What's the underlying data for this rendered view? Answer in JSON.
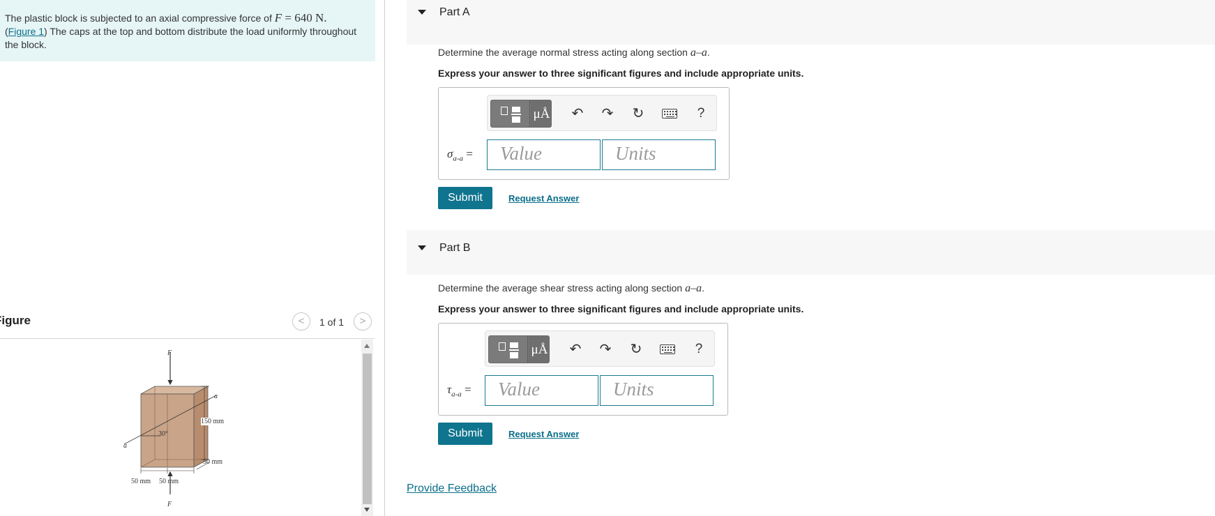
{
  "problem": {
    "text_pre": "The plastic block is subjected to an axial compressive force of ",
    "force_symbol": "F",
    "force_value": " = 640 N.",
    "figure_link": "Figure 1",
    "text_post": ") The caps at the top and bottom distribute the load uniformly throughout the block."
  },
  "figure": {
    "title": "Figure",
    "pager_prev": "<",
    "pager_next": ">",
    "pager_count": "1 of 1",
    "labels": {
      "force_top": "F",
      "force_bottom": "F",
      "section_right": "a",
      "section_left": "a",
      "angle": "30°",
      "height": "150 mm",
      "depth": "50 mm",
      "width_left": "50 mm",
      "width_right": "50 mm"
    },
    "block_color": "#c9a488"
  },
  "parts": [
    {
      "title": "Part A",
      "question_pre": "Determine the average normal stress acting along section ",
      "section": "a–a",
      "question_post": ".",
      "instruction": "Express your answer to three significant figures and include appropriate units.",
      "symbol": "σ",
      "subscript": "a-a",
      "equals": "=",
      "value_placeholder": "Value",
      "units_placeholder": "Units",
      "submit": "Submit",
      "request": "Request Answer"
    },
    {
      "title": "Part B",
      "question_pre": "Determine the average shear stress acting along section ",
      "section": "a–a",
      "question_post": ".",
      "instruction": "Express your answer to three significant figures and include appropriate units.",
      "symbol": "τ",
      "subscript": "a-a",
      "equals": "=",
      "value_placeholder": "Value",
      "units_placeholder": "Units",
      "submit": "Submit",
      "request": "Request Answer"
    }
  ],
  "toolbar": {
    "units_glyph": "μÅ",
    "undo_icon": "↶",
    "redo_icon": "↷",
    "reset_icon": "↻",
    "help": "?"
  },
  "feedback": "Provide Feedback",
  "colors": {
    "problem_bg": "#e6f5f6",
    "accent": "#0f748e",
    "link": "#0a6e8a"
  }
}
